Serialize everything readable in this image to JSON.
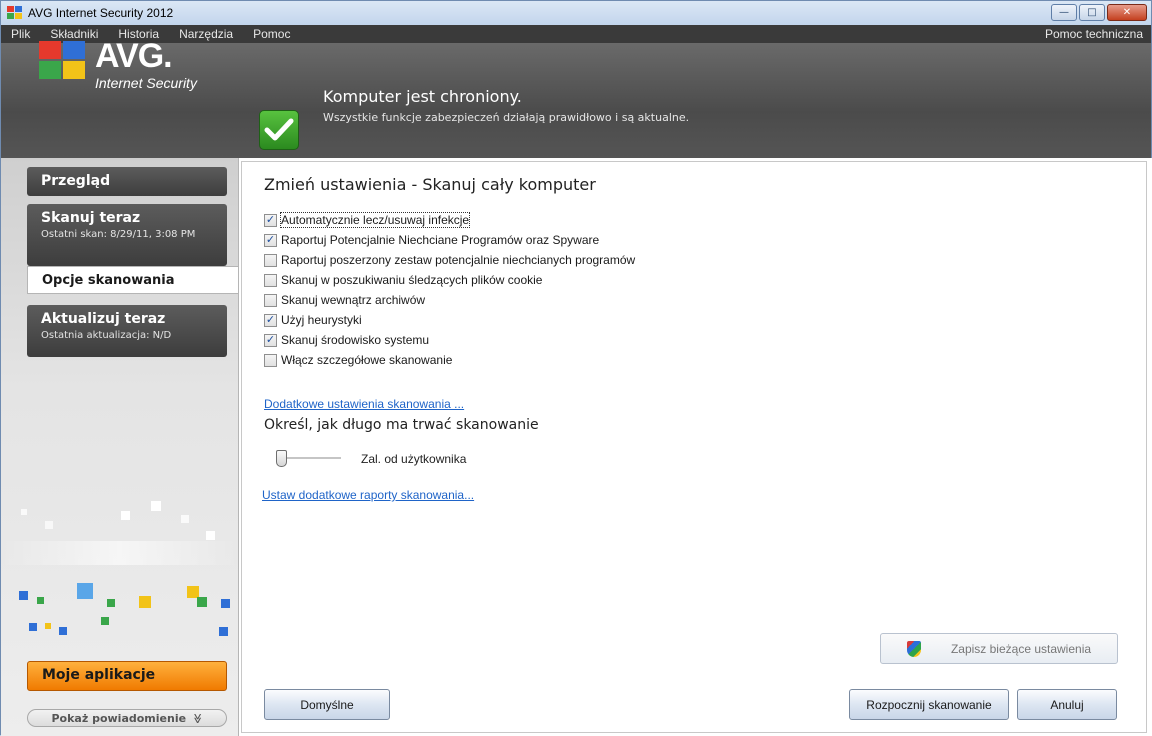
{
  "window": {
    "title": "AVG Internet Security 2012",
    "controls": {
      "minimize": "—",
      "maximize": "□",
      "close": "✕"
    }
  },
  "menu": {
    "items": [
      "Plik",
      "Składniki",
      "Historia",
      "Narzędzia",
      "Pomoc"
    ],
    "right": "Pomoc techniczna"
  },
  "header": {
    "logo_main": "AVG.",
    "logo_sub": "Internet Security",
    "status_title": "Komputer jest chroniony.",
    "status_sub": "Wszystkie funkcje zabezpieczeń działają prawidłowo i są aktualne."
  },
  "sidebar": {
    "overview": "Przegląd",
    "scan_now": "Skanuj teraz",
    "scan_now_sub": "Ostatni skan: 8/29/11, 3:08 PM",
    "scan_options": "Opcje skanowania",
    "update_now": "Aktualizuj teraz",
    "update_now_sub": "Ostatnia aktualizacja: N/D",
    "my_apps": "Moje aplikacje",
    "show_notification": "Pokaż powiadomienie",
    "show_notification_icon": "≫"
  },
  "content": {
    "title": "Zmień ustawienia - Skanuj cały komputer",
    "options": [
      {
        "label": "Automatycznie lecz/usuwaj infekcje",
        "checked": true
      },
      {
        "label": "Raportuj Potencjalnie Niechciane Programów oraz Spyware",
        "checked": true
      },
      {
        "label": "Raportuj poszerzony zestaw potencjalnie niechcianych programów",
        "checked": false
      },
      {
        "label": "Skanuj w poszukiwaniu śledzących plików cookie",
        "checked": false
      },
      {
        "label": "Skanuj wewnątrz archiwów",
        "checked": false
      },
      {
        "label": "Użyj heurystyki",
        "checked": true
      },
      {
        "label": "Skanuj środowisko systemu",
        "checked": true
      },
      {
        "label": "Włącz szczegółowe skanowanie",
        "checked": false
      }
    ],
    "extra_settings_link": "Dodatkowe ustawienia skanowania ...",
    "duration_title": "Określ, jak długo ma trwać skanowanie",
    "duration_label": "Zal. od użytkownika",
    "duration_level": 0,
    "reports_link": "Ustaw dodatkowe raporty skanowania..."
  },
  "buttons": {
    "save": "Zapisz bieżące ustawienia",
    "defaults": "Domyślne",
    "start_scan": "Rozpocznij skanowanie",
    "cancel": "Anuluj"
  },
  "colors": {
    "accent_orange": "#f07a00",
    "link_blue": "#1f64c8",
    "status_green": "#2b8a1f"
  }
}
